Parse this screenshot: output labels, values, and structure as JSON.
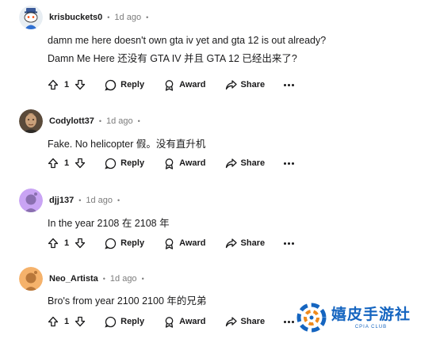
{
  "comments": [
    {
      "username": "krisbuckets0",
      "time": "1d ago",
      "lines": [
        "damn me here doesn't own gta iv yet and gta 12 is out already?",
        "Damn Me Here 还没有 GTA IV 并且 GTA 12 已经出来了?"
      ],
      "votes": "1",
      "reply": "Reply",
      "award": "Award",
      "share": "Share"
    },
    {
      "username": "Codylott37",
      "time": "1d ago",
      "lines": [
        "Fake. No helicopter  假。没有直升机"
      ],
      "votes": "1",
      "reply": "Reply",
      "award": "Award",
      "share": "Share"
    },
    {
      "username": "djj137",
      "time": "1d ago",
      "lines": [
        "In the year 2108  在 2108 年"
      ],
      "votes": "1",
      "reply": "Reply",
      "award": "Award",
      "share": "Share"
    },
    {
      "username": "Neo_Artista",
      "time": "1d ago",
      "lines": [
        "Bro's from year 2100  2100 年的兄弟"
      ],
      "votes": "1",
      "reply": "Reply",
      "award": "Award",
      "share": "Share"
    }
  ],
  "separator": "•",
  "watermark": {
    "title": "嬉皮手游社",
    "subtitle": "CPIA CLUB"
  },
  "colors": {
    "text": "#1a1a1b",
    "muted": "#7c7c7c",
    "avatar_purple": "#c9a4f4",
    "avatar_orange": "#f5b26b",
    "watermark": "#1565c0"
  }
}
